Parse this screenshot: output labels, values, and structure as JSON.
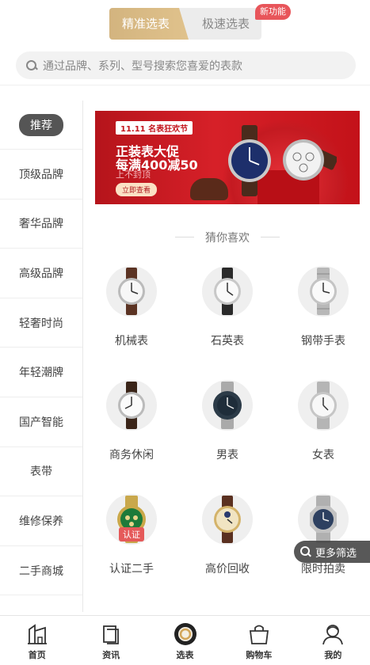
{
  "header": {
    "toggle_active": "精准选表",
    "toggle_inactive": "极速选表",
    "new_badge": "新功能"
  },
  "search": {
    "placeholder": "通过品牌、系列、型号搜索您喜爱的表款"
  },
  "sidebar": {
    "items": [
      {
        "label": "推荐",
        "active": true
      },
      {
        "label": "顶级品牌"
      },
      {
        "label": "奢华品牌"
      },
      {
        "label": "高级品牌"
      },
      {
        "label": "轻奢时尚"
      },
      {
        "label": "年轻潮牌"
      },
      {
        "label": "国产智能"
      },
      {
        "label": "表带"
      },
      {
        "label": "维修保养"
      },
      {
        "label": "二手商城"
      }
    ]
  },
  "banner": {
    "tag": "11.11 名表狂欢节",
    "line1": "正装表大促",
    "line2": "每满400减50",
    "line3": "上不封顶",
    "button": "立即查看"
  },
  "section": {
    "title": "猜你喜欢"
  },
  "categories": [
    {
      "label": "机械表",
      "icon": "leather-watch-icon"
    },
    {
      "label": "石英表",
      "icon": "dark-strap-watch-icon"
    },
    {
      "label": "钢带手表",
      "icon": "steel-watch-icon"
    },
    {
      "label": "商务休闲",
      "icon": "business-watch-icon"
    },
    {
      "label": "男表",
      "icon": "diver-watch-icon"
    },
    {
      "label": "女表",
      "icon": "ladies-watch-icon"
    },
    {
      "label": "认证二手",
      "icon": "gold-watch-icon",
      "badge": "认证"
    },
    {
      "label": "高价回收",
      "icon": "gold-dress-watch-icon"
    },
    {
      "label": "限时拍卖",
      "icon": "octagon-watch-icon"
    }
  ],
  "more_filter": "更多筛选",
  "tabbar": {
    "items": [
      {
        "label": "首页",
        "icon": "home-icon"
      },
      {
        "label": "资讯",
        "icon": "news-icon"
      },
      {
        "label": "选表",
        "icon": "watch-select-icon"
      },
      {
        "label": "购物车",
        "icon": "cart-icon"
      },
      {
        "label": "我的",
        "icon": "profile-icon"
      }
    ]
  },
  "colors": {
    "accent_gold": "#d3b47f",
    "badge_red": "#e8555a",
    "banner_red": "#d62028"
  }
}
